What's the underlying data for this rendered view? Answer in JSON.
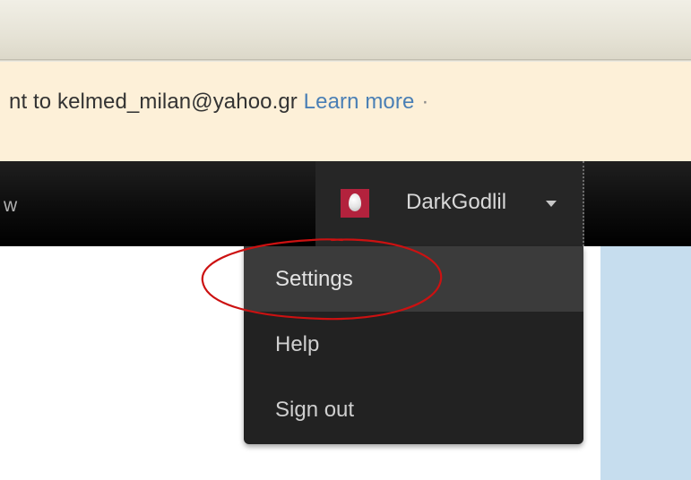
{
  "notice": {
    "text": "nt to kelmed_milan@yahoo.gr ",
    "link_label": "Learn more",
    "trailing": "·"
  },
  "navbar": {
    "left_item_fragment": "w"
  },
  "user_menu": {
    "username": "DarkGodlil",
    "avatar_icon": "egg-avatar-icon",
    "avatar_color": "#b3223d"
  },
  "dropdown": {
    "items": [
      {
        "label": "Settings",
        "highlighted": true
      },
      {
        "label": "Help",
        "highlighted": false
      },
      {
        "label": "Sign out",
        "highlighted": false
      }
    ]
  },
  "annotation": {
    "color": "#cc1111",
    "target": "Settings"
  },
  "colors": {
    "navbar": "#111111",
    "notice_bg": "#fdf0d8",
    "link": "#4a7fb5",
    "side_panel": "#c6ddee",
    "dropdown_bg": "#222222",
    "dropdown_active": "#3b3b3b"
  }
}
